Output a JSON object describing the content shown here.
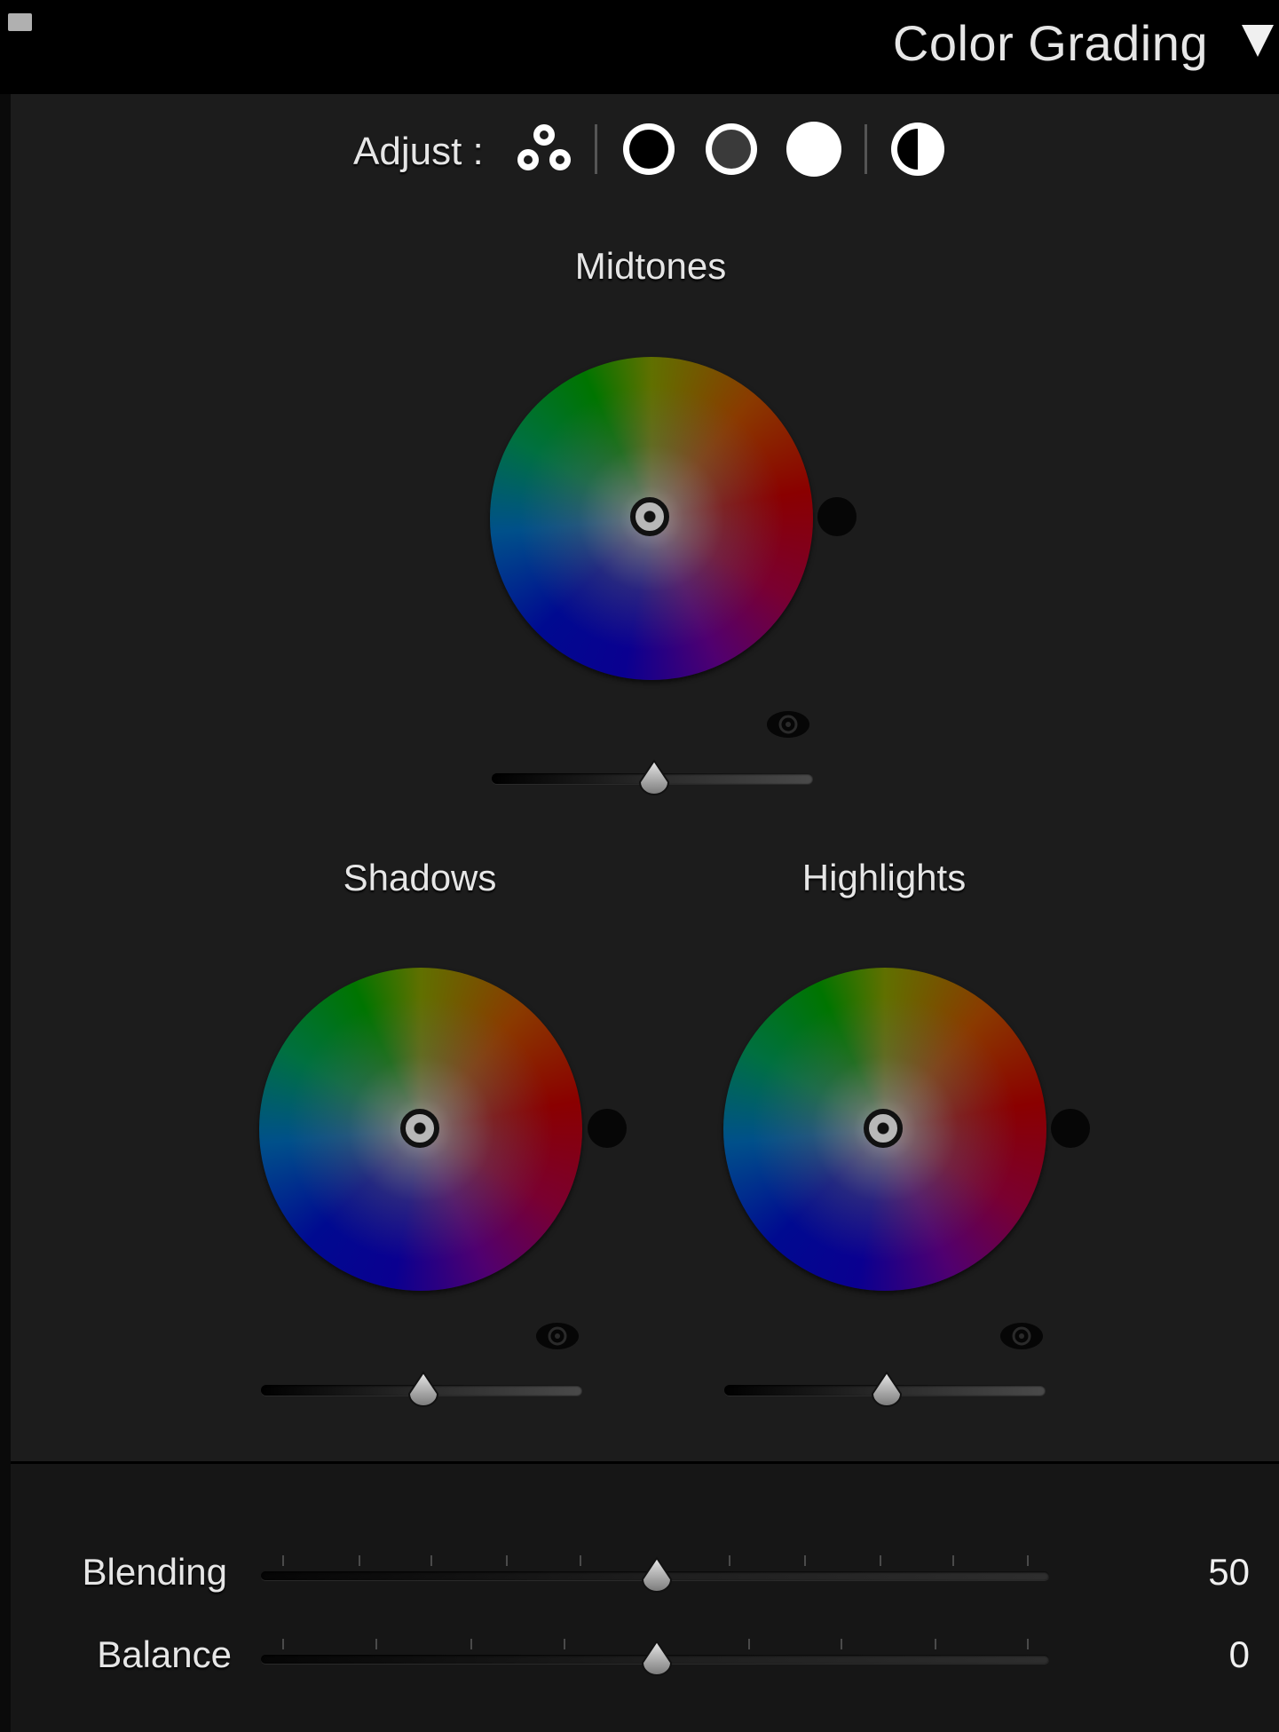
{
  "header": {
    "title": "Color Grading"
  },
  "adjust": {
    "label": "Adjust :",
    "modes": [
      {
        "name": "3-way",
        "icon": "three-circles-icon"
      },
      {
        "name": "shadows",
        "icon": "ring-black-icon"
      },
      {
        "name": "midtones",
        "icon": "ring-gray-icon"
      },
      {
        "name": "highlights",
        "icon": "filled-white-circle-icon"
      },
      {
        "name": "global",
        "icon": "half-circle-icon"
      }
    ]
  },
  "wheels": {
    "midtones": {
      "label": "Midtones"
    },
    "shadows": {
      "label": "Shadows"
    },
    "highlights": {
      "label": "Highlights"
    }
  },
  "sliders": {
    "blending": {
      "label": "Blending",
      "value": "50"
    },
    "balance": {
      "label": "Balance",
      "value": "0"
    }
  },
  "colors": {
    "background": "#1c1c1c",
    "header": "#000000",
    "text": "#e6e6e6"
  }
}
